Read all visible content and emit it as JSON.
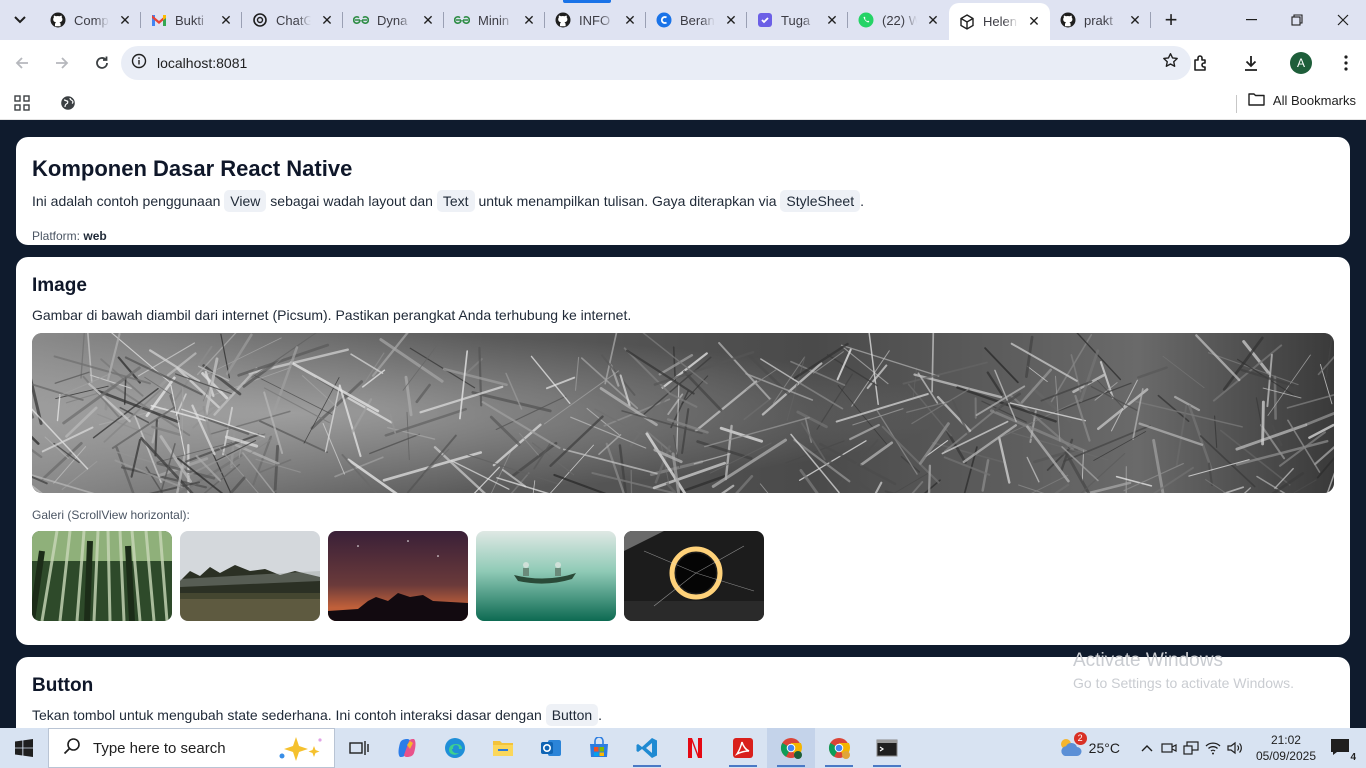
{
  "browser": {
    "tabs": [
      {
        "title": "Comp",
        "icon": "github-icon"
      },
      {
        "title": "Bukti",
        "icon": "gmail-icon"
      },
      {
        "title": "ChatG",
        "icon": "chatgpt-icon"
      },
      {
        "title": "Dyna",
        "icon": "geeksforgeeks-icon"
      },
      {
        "title": "Minin",
        "icon": "geeksforgeeks-icon"
      },
      {
        "title": "INFO",
        "icon": "github-icon"
      },
      {
        "title": "Beran",
        "icon": "canva-icon"
      },
      {
        "title": "Tuga",
        "icon": "teams-icon"
      },
      {
        "title": "(22) W",
        "icon": "whatsapp-icon"
      },
      {
        "title": "Helen",
        "icon": "expo-icon",
        "active": true
      },
      {
        "title": "prakt",
        "icon": "github-icon"
      }
    ],
    "url": "localhost:8081",
    "profile_initial": "A",
    "bookmarks_label": "All Bookmarks"
  },
  "page": {
    "intro": {
      "title": "Komponen Dasar React Native",
      "desc_1": "Ini adalah contoh penggunaan",
      "code_view": "View",
      "desc_2": "sebagai wadah layout dan",
      "code_text": "Text",
      "desc_3": "untuk menampilkan tulisan. Gaya diterapkan via",
      "code_stylesheet": "StyleSheet",
      "desc_4": ".",
      "platform_label": "Platform:",
      "platform_value": "web"
    },
    "image_section": {
      "title": "Image",
      "desc": "Gambar di bawah diambil dari internet (Picsum). Pastikan perangkat Anda terhubung ke internet.",
      "gallery_label": "Galeri (ScrollView horizontal):",
      "gallery_items": [
        "bamboo forest",
        "pine treeline over field",
        "night sky silhouette",
        "canoe on green lake",
        "light painting ring"
      ]
    },
    "button_section": {
      "title": "Button",
      "desc": "Tekan tombol untuk mengubah state sederhana. Ini contoh interaksi dasar dengan",
      "code_button": "Button",
      "desc_end": "."
    }
  },
  "watermark": {
    "line1": "Activate Windows",
    "line2": "Go to Settings to activate Windows."
  },
  "taskbar": {
    "search_placeholder": "Type here to search",
    "weather_temp": "25°C",
    "weather_badge": "2",
    "time": "21:02",
    "date": "05/09/2025",
    "notification_count": "4"
  },
  "colors": {
    "page_bg": "#0f1b2d",
    "card_bg": "#ffffff",
    "tab_strip": "#dfe3f2",
    "accent": "#1a73e8"
  }
}
